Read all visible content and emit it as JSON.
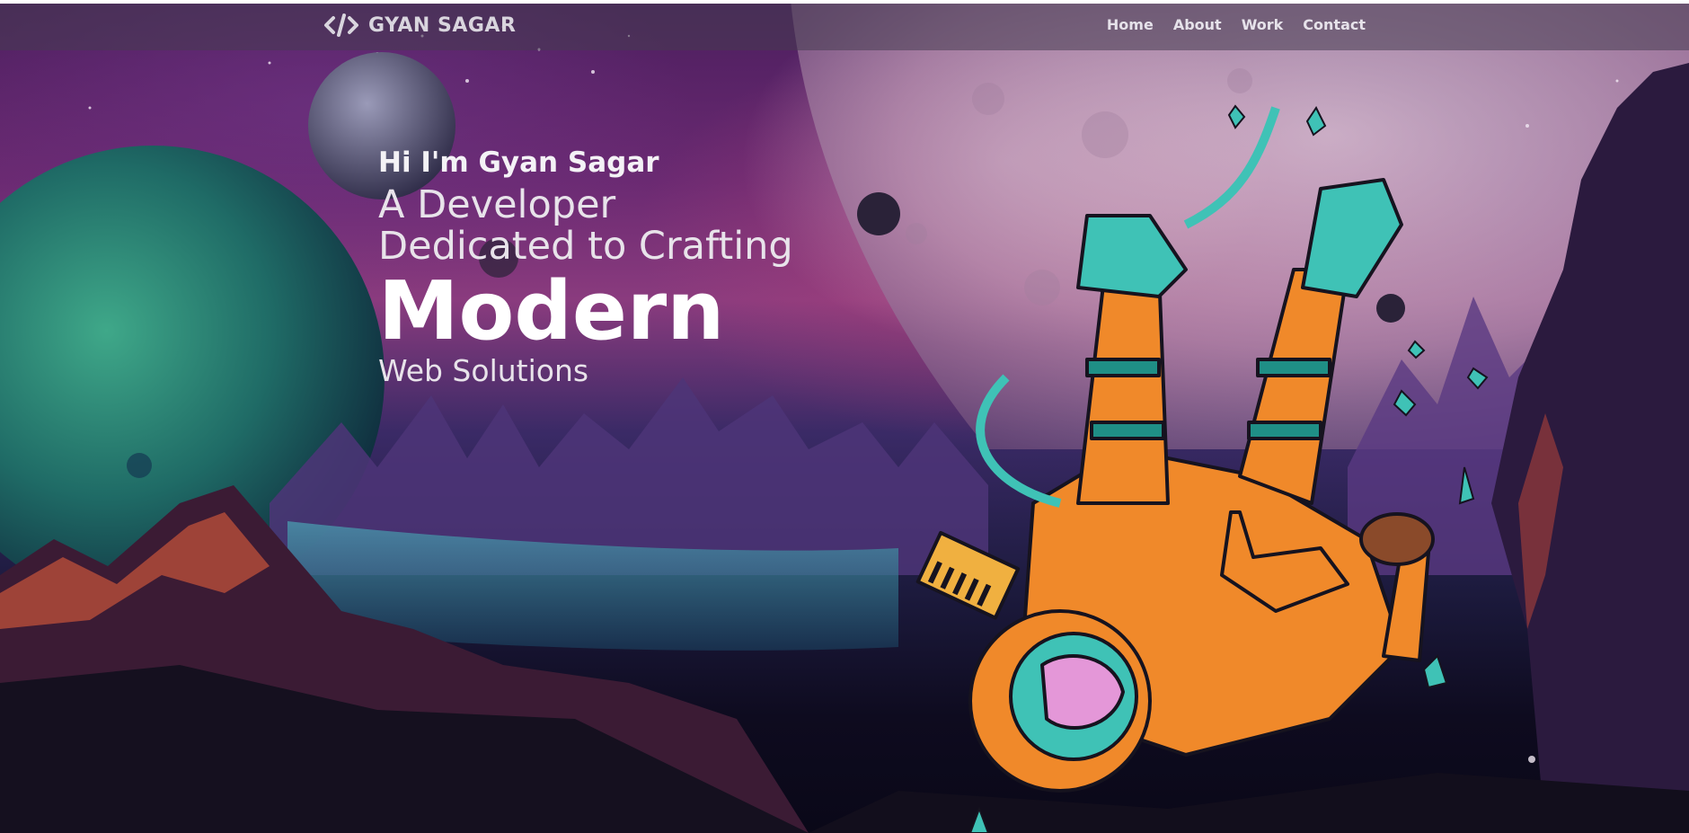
{
  "brand": {
    "name": "GYAN SAGAR",
    "logo_icon": "code-brackets-icon"
  },
  "nav": {
    "items": [
      {
        "label": "Home"
      },
      {
        "label": "About"
      },
      {
        "label": "Work"
      },
      {
        "label": "Contact"
      }
    ]
  },
  "hero": {
    "greeting": "Hi I'm Gyan Sagar",
    "line1": "A Developer",
    "line2": "Dedicated to Crafting",
    "emphasis": "Modern",
    "line3": "Web Solutions"
  },
  "illustration": {
    "subject": "astronaut-illustration",
    "colors": {
      "suit": "#f0892a",
      "accent": "#3fc2b6",
      "outline": "#16131f"
    }
  }
}
